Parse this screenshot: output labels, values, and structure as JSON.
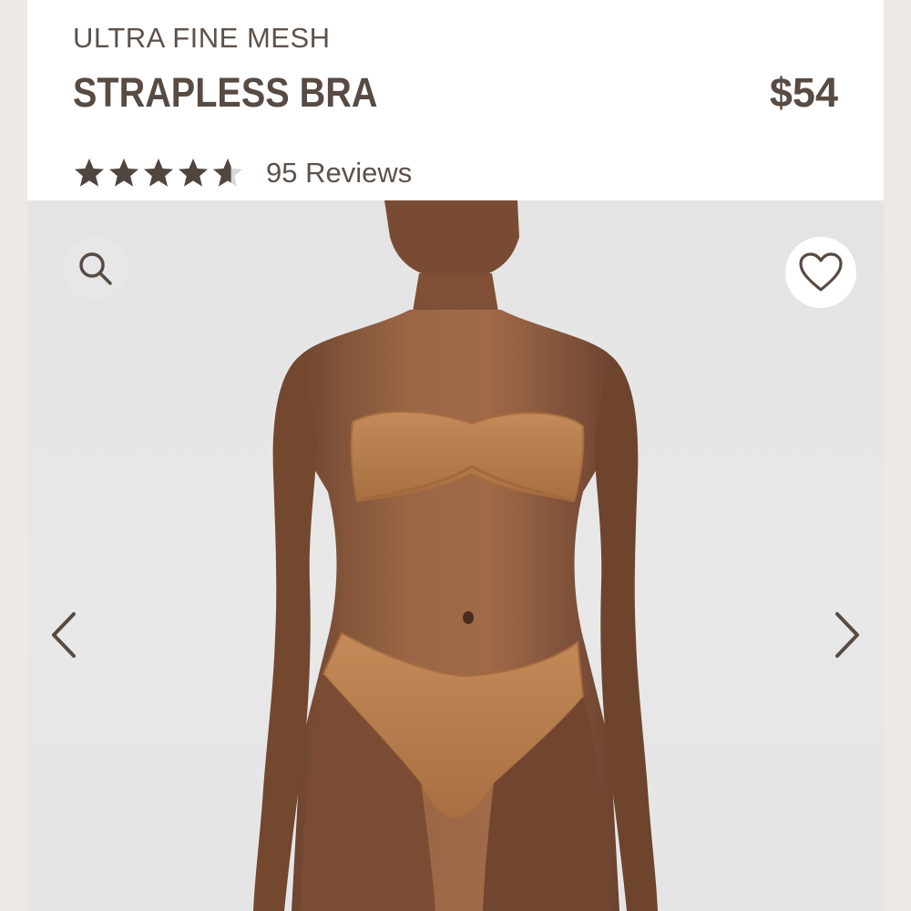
{
  "product": {
    "collection": "ULTRA FINE MESH",
    "name": "STRAPLESS BRA",
    "price": "$54",
    "rating": 4.6,
    "rating_max": 5,
    "reviews_label": "95 Reviews"
  },
  "gallery": {
    "zoom_icon": "search-icon",
    "favorite_icon": "heart-outline-icon",
    "prev_icon": "chevron-left-icon",
    "next_icon": "chevron-right-icon"
  },
  "colors": {
    "text": "#574b43",
    "star_filled": "#4f4640",
    "star_empty": "#d9d6d3",
    "gallery_bg": "#e6e6e7",
    "garment": "#b57b4c",
    "skin": "#8a5a3c"
  }
}
